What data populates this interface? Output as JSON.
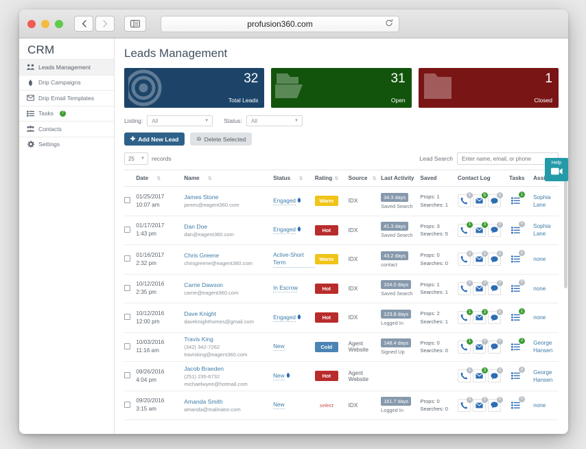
{
  "browser": {
    "url": "profusion360.com",
    "back_icon": "chevron-left-icon",
    "forward_icon": "chevron-right-icon",
    "sidebar_icon": "sidebar-toggle-icon",
    "reload_icon": "reload-icon"
  },
  "sidebar": {
    "brand": "CRM",
    "items": [
      {
        "label": "Leads Management",
        "icon": "leads-icon",
        "active": true,
        "badge": null
      },
      {
        "label": "Drip Campaigns",
        "icon": "flame-icon",
        "active": false,
        "badge": null
      },
      {
        "label": "Drip Email Templates",
        "icon": "envelope-icon",
        "active": false,
        "badge": null
      },
      {
        "label": "Tasks",
        "icon": "list-icon",
        "active": false,
        "badge": "7"
      },
      {
        "label": "Contacts",
        "icon": "contacts-icon",
        "active": false,
        "badge": null
      },
      {
        "label": "Settings",
        "icon": "gear-icon",
        "active": false,
        "badge": null
      }
    ]
  },
  "main": {
    "title": "Leads Management",
    "cards": [
      {
        "value": "32",
        "label": "Total Leads",
        "color": "#1c4469",
        "watermark": "target-icon"
      },
      {
        "value": "31",
        "label": "Open",
        "color": "#13540d",
        "watermark": "folder-open-icon"
      },
      {
        "value": "1",
        "label": "Closed",
        "color": "#7a1515",
        "watermark": "folder-closed-icon"
      }
    ],
    "filters": {
      "listing_label": "Listing:",
      "listing_value": "All",
      "status_label": "Status:",
      "status_value": "All"
    },
    "buttons": {
      "add_lead": "Add New Lead",
      "delete_selected": "Delete Selected"
    },
    "records": {
      "count": "25",
      "label": "records"
    },
    "search": {
      "label": "Lead Search",
      "placeholder": "Enter name, email, or phone",
      "value": ""
    },
    "help_widget": {
      "label": "Help",
      "icon": "video-camera-icon"
    },
    "table": {
      "headers": [
        {
          "label": "Date",
          "sortable": true
        },
        {
          "label": "Name",
          "sortable": true
        },
        {
          "label": "Status",
          "sortable": true
        },
        {
          "label": "Rating",
          "sortable": true
        },
        {
          "label": "Source",
          "sortable": true
        },
        {
          "label": "Last Activity",
          "sortable": false
        },
        {
          "label": "Saved",
          "sortable": false
        },
        {
          "label": "Contact Log",
          "sortable": false
        },
        {
          "label": "Tasks",
          "sortable": false
        },
        {
          "label": "Assigned",
          "sortable": false
        }
      ],
      "rows": [
        {
          "date": "01/25/2017",
          "time": "10:07 am",
          "name": "James Stone",
          "phone": "",
          "email": "james@eagent360.com",
          "status": "Engaged",
          "status_flame": true,
          "rating": "Warm",
          "rating_type": "warm",
          "source": "IDX",
          "activity_days": "34.3 days",
          "activity_type": "Saved Search",
          "saved_props": "Props: 1",
          "saved_searches": "Searches: 1",
          "log": {
            "calls": "0",
            "emails": "5",
            "texts": "0"
          },
          "tasks": "1",
          "assigned": "Sophia Lane"
        },
        {
          "date": "01/17/2017",
          "time": "1:43 pm",
          "name": "Dan Doe",
          "phone": "",
          "email": "dan@eagent360.com",
          "status": "Engaged",
          "status_flame": true,
          "rating": "Hot",
          "rating_type": "hot",
          "source": "IDX",
          "activity_days": "41.3 days",
          "activity_type": "Saved Search",
          "saved_props": "Props: 3",
          "saved_searches": "Searches: 5",
          "log": {
            "calls": "1",
            "emails": "3",
            "texts": "0"
          },
          "tasks": "0",
          "assigned": "Sophia Lane"
        },
        {
          "date": "01/16/2017",
          "time": "2:32 pm",
          "name": "Chris Greene",
          "phone": "",
          "email": "chrisgreene@eagent360.com",
          "status": "Active-Short Term",
          "status_flame": false,
          "rating": "Warm",
          "rating_type": "warm",
          "source": "IDX",
          "activity_days": "43.2 days",
          "activity_type": "contact",
          "saved_props": "Props: 0",
          "saved_searches": "Searches: 0",
          "log": {
            "calls": "0",
            "emails": "0",
            "texts": "0"
          },
          "tasks": "0",
          "assigned": "none"
        },
        {
          "date": "10/12/2016",
          "time": "2:35 pm",
          "name": "Carrie Dawson",
          "phone": "",
          "email": "carrie@eagent360.com",
          "status": "In Escrow",
          "status_flame": false,
          "rating": "Hot",
          "rating_type": "hot",
          "source": "IDX",
          "activity_days": "104.0 days",
          "activity_type": "Saved Search",
          "saved_props": "Props: 1",
          "saved_searches": "Searches: 1",
          "log": {
            "calls": "0",
            "emails": "0",
            "texts": "0"
          },
          "tasks": "0",
          "assigned": "none"
        },
        {
          "date": "10/12/2016",
          "time": "12:00 pm",
          "name": "Dave Knight",
          "phone": "",
          "email": "daveknighthomes@gmail.com",
          "status": "Engaged",
          "status_flame": true,
          "rating": "Hot",
          "rating_type": "hot",
          "source": "IDX",
          "activity_days": "123.8 days",
          "activity_type": "Logged In",
          "saved_props": "Props: 2",
          "saved_searches": "Searches: 1",
          "log": {
            "calls": "1",
            "emails": "3",
            "texts": "0"
          },
          "tasks": "1",
          "assigned": "none"
        },
        {
          "date": "10/03/2016",
          "time": "11:16 am",
          "name": "Travis King",
          "phone": "(342) 342-7262",
          "email": "travisking@eagent360.com",
          "status": "New",
          "status_flame": false,
          "rating": "Cold",
          "rating_type": "cold",
          "source": "Agent Website",
          "activity_days": "148.4 days",
          "activity_type": "Signed Up",
          "saved_props": "Props: 0",
          "saved_searches": "Searches: 0",
          "log": {
            "calls": "1",
            "emails": "0",
            "texts": "0"
          },
          "tasks": "2",
          "assigned": "George Hansen"
        },
        {
          "date": "09/26/2016",
          "time": "4:04 pm",
          "name": "Jacob Braeden",
          "phone": "(251) 235-6732",
          "email": "michaelwyee@hotmail.com",
          "status": "New",
          "status_flame": true,
          "rating": "Hot",
          "rating_type": "hot",
          "source": "Agent Website",
          "activity_days": "",
          "activity_type": "",
          "saved_props": "",
          "saved_searches": "",
          "log": {
            "calls": "0",
            "emails": "3",
            "texts": "0"
          },
          "tasks": "0",
          "assigned": "George Hansen"
        },
        {
          "date": "09/20/2016",
          "time": "3:15 am",
          "name": "Amanda Smith",
          "phone": "",
          "email": "amanda@malinator.com",
          "status": "New",
          "status_flame": false,
          "rating": "select",
          "rating_type": "select",
          "source": "IDX",
          "activity_days": "161.7 days",
          "activity_type": "Logged In",
          "saved_props": "Props: 0",
          "saved_searches": "Searches: 0",
          "log": {
            "calls": "0",
            "emails": "0",
            "texts": "0"
          },
          "tasks": "0",
          "assigned": "none"
        }
      ]
    }
  }
}
